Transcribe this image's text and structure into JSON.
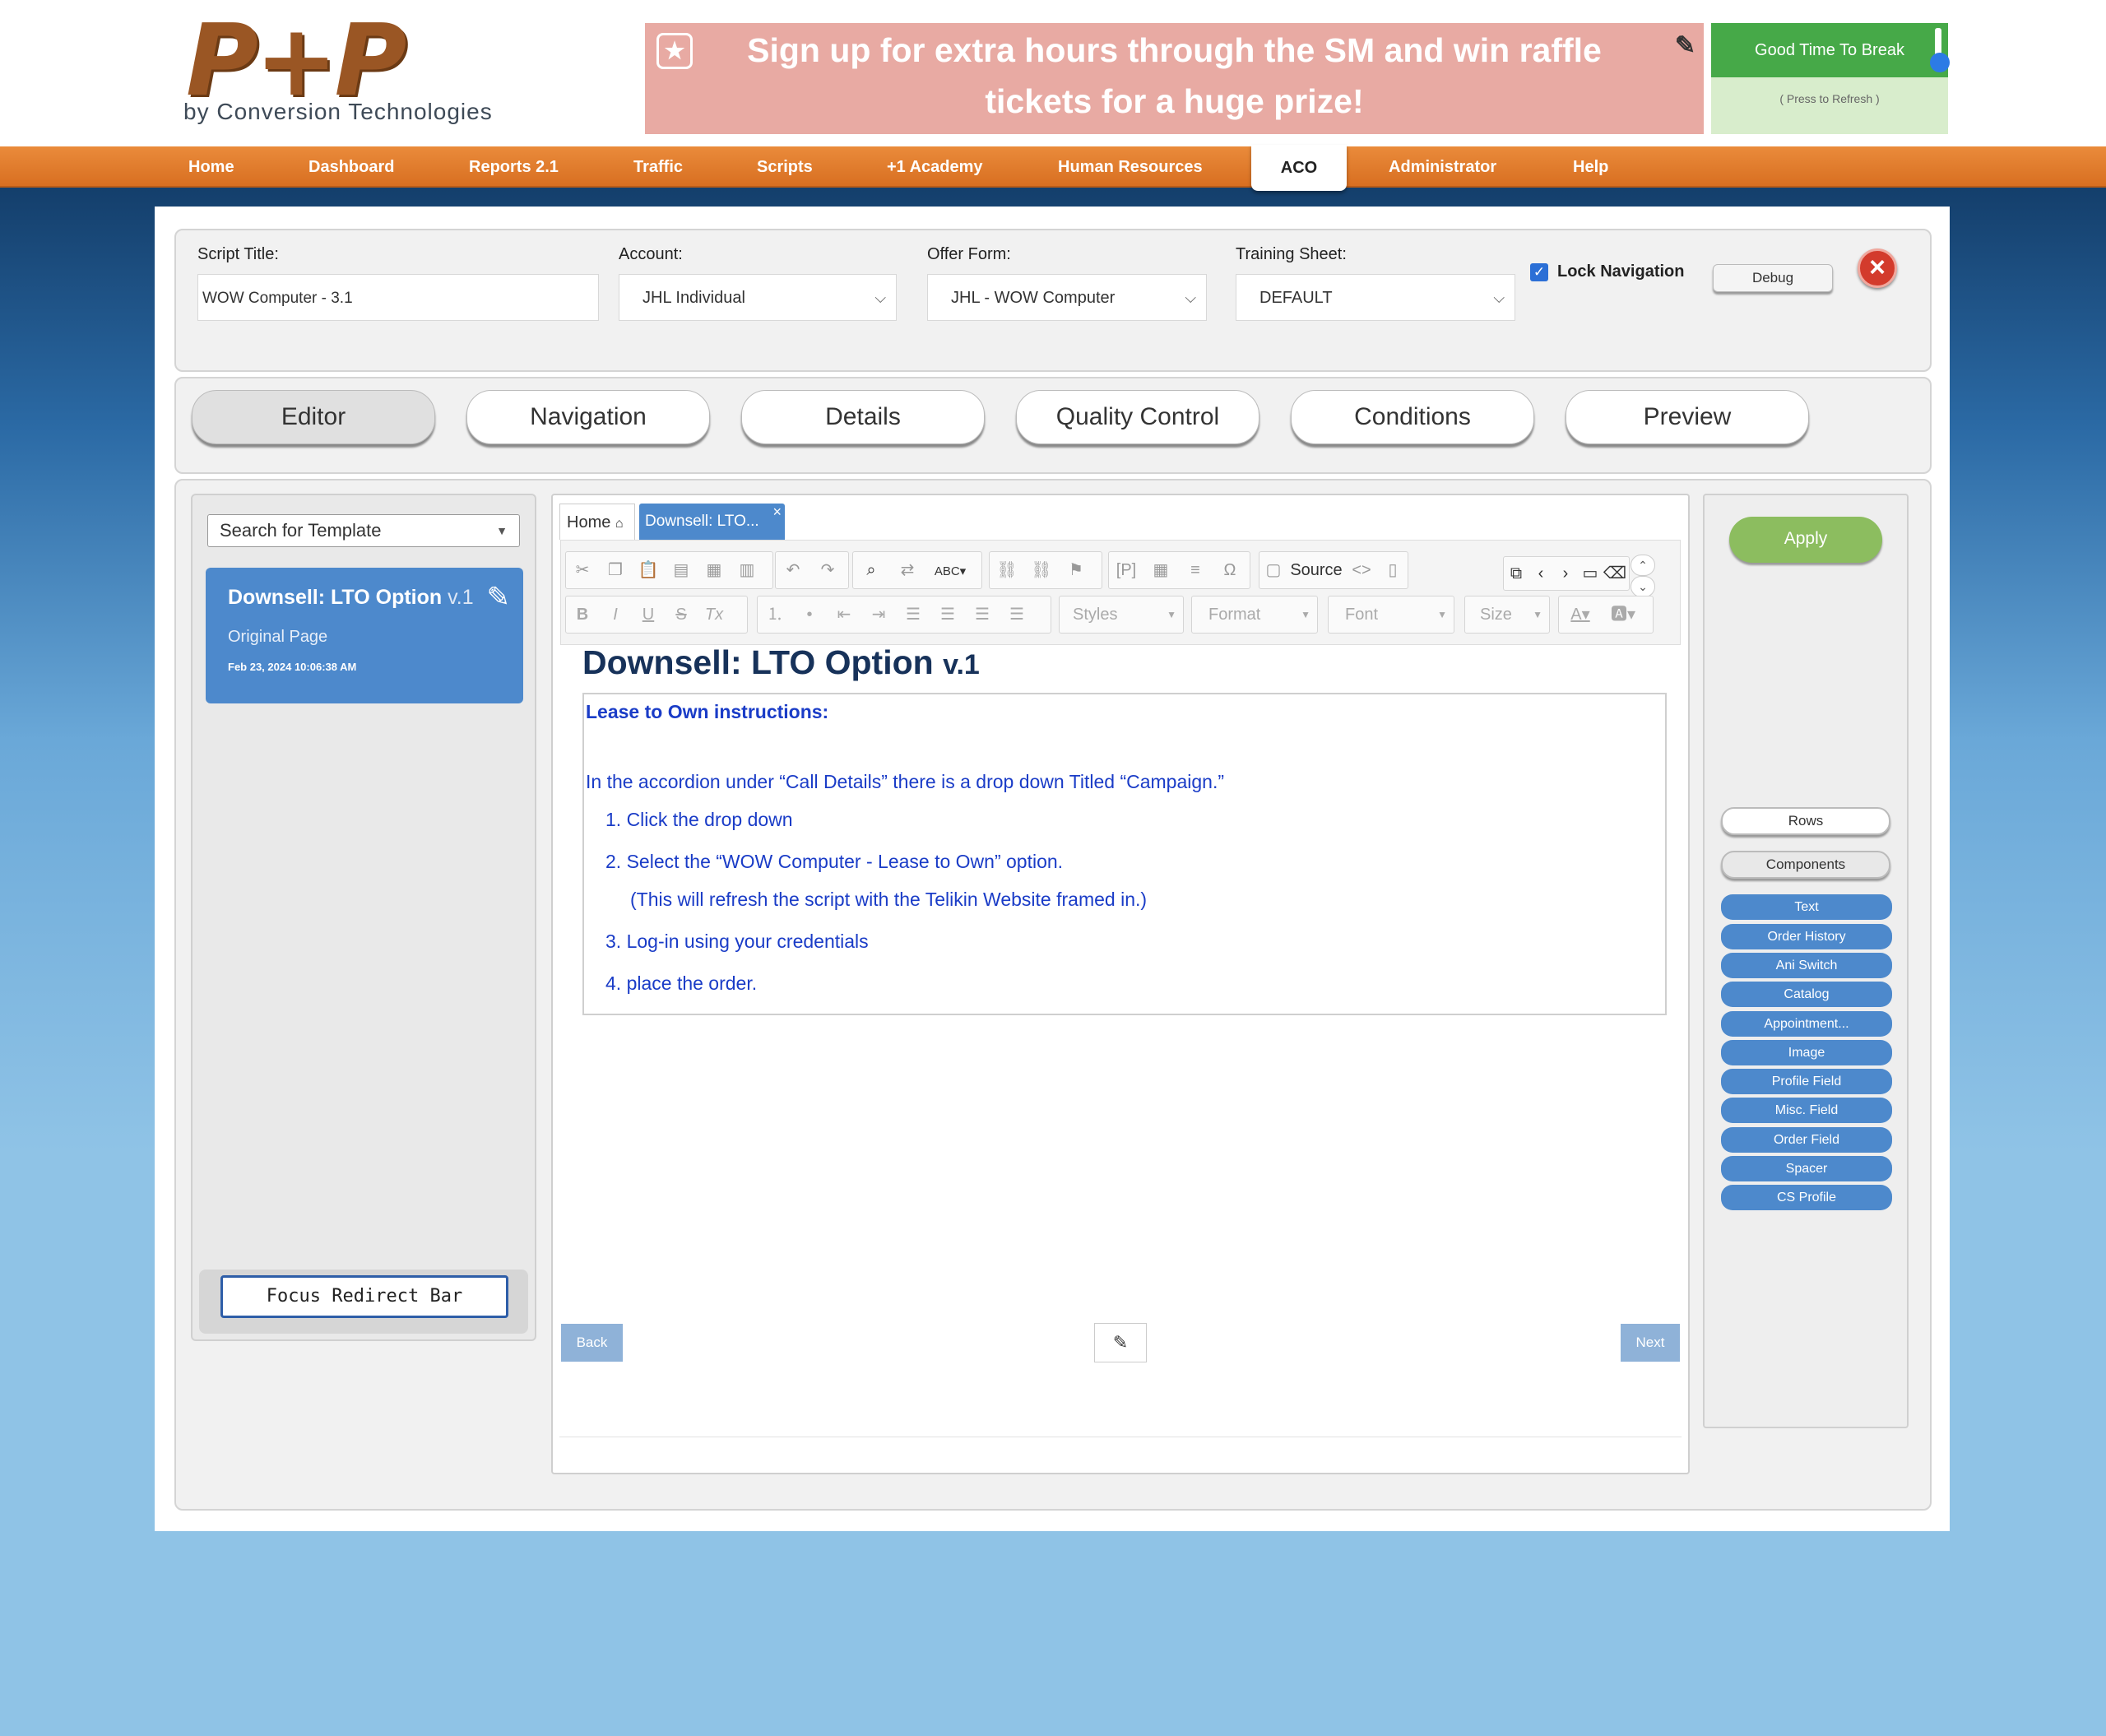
{
  "logo": {
    "big": "P+P",
    "sub": "by Conversion Technologies"
  },
  "banner": {
    "text": "Sign up for extra hours through the SM and win raffle tickets for a huge prize!"
  },
  "break_widget": {
    "title": "Good Time To Break",
    "sub": "( Press to Refresh )"
  },
  "nav": [
    "Home",
    "Dashboard",
    "Reports 2.1",
    "Traffic",
    "Scripts",
    "+1 Academy",
    "Human Resources",
    "ACO",
    "Administrator",
    "Help"
  ],
  "script": {
    "title_label": "Script Title:",
    "title_value": "WOW Computer -  3.1",
    "account_label": "Account:",
    "account_value": "JHL Individual",
    "offer_label": "Offer Form:",
    "offer_value": "JHL - WOW Computer",
    "training_label": "Training Sheet:",
    "training_value": "DEFAULT",
    "lock_label": "Lock Navigation",
    "debug_label": "Debug"
  },
  "tabs": [
    "Editor",
    "Navigation",
    "Details",
    "Quality Control",
    "Conditions",
    "Preview"
  ],
  "left": {
    "search_placeholder": "Search for Template",
    "card": {
      "title": "Downsell: LTO Option",
      "version": "v.1",
      "subtitle": "Original Page",
      "date": "Feb 23, 2024 10:06:38 AM"
    },
    "focus_button": "Focus Redirect Bar"
  },
  "editor": {
    "tab_home": "Home",
    "tab_active": "Downsell: LTO...",
    "source_label": "Source",
    "styles": "Styles",
    "format": "Format",
    "font": "Font",
    "size": "Size",
    "heading": "Downsell: LTO Option",
    "heading_version": "v.1",
    "content": {
      "title": "Lease to Own instructions:",
      "intro": "In the accordion under “Call Details” there is a drop down Titled “Campaign.”",
      "steps": [
        "1. Click the drop down",
        "2. Select the “WOW Computer - Lease to Own” option.",
        "(This will refresh the script with the Telikin Website framed in.)",
        "3. Log-in using your credentials",
        "4. place the order."
      ]
    },
    "back": "Back",
    "next": "Next"
  },
  "right": {
    "apply": "Apply",
    "rows": "Rows",
    "components": "Components",
    "items": [
      "Text",
      "Order History",
      "Ani Switch",
      "Catalog",
      "Appointment...",
      "Image",
      "Profile Field",
      "Misc. Field",
      "Order Field",
      "Spacer",
      "CS Profile"
    ]
  }
}
